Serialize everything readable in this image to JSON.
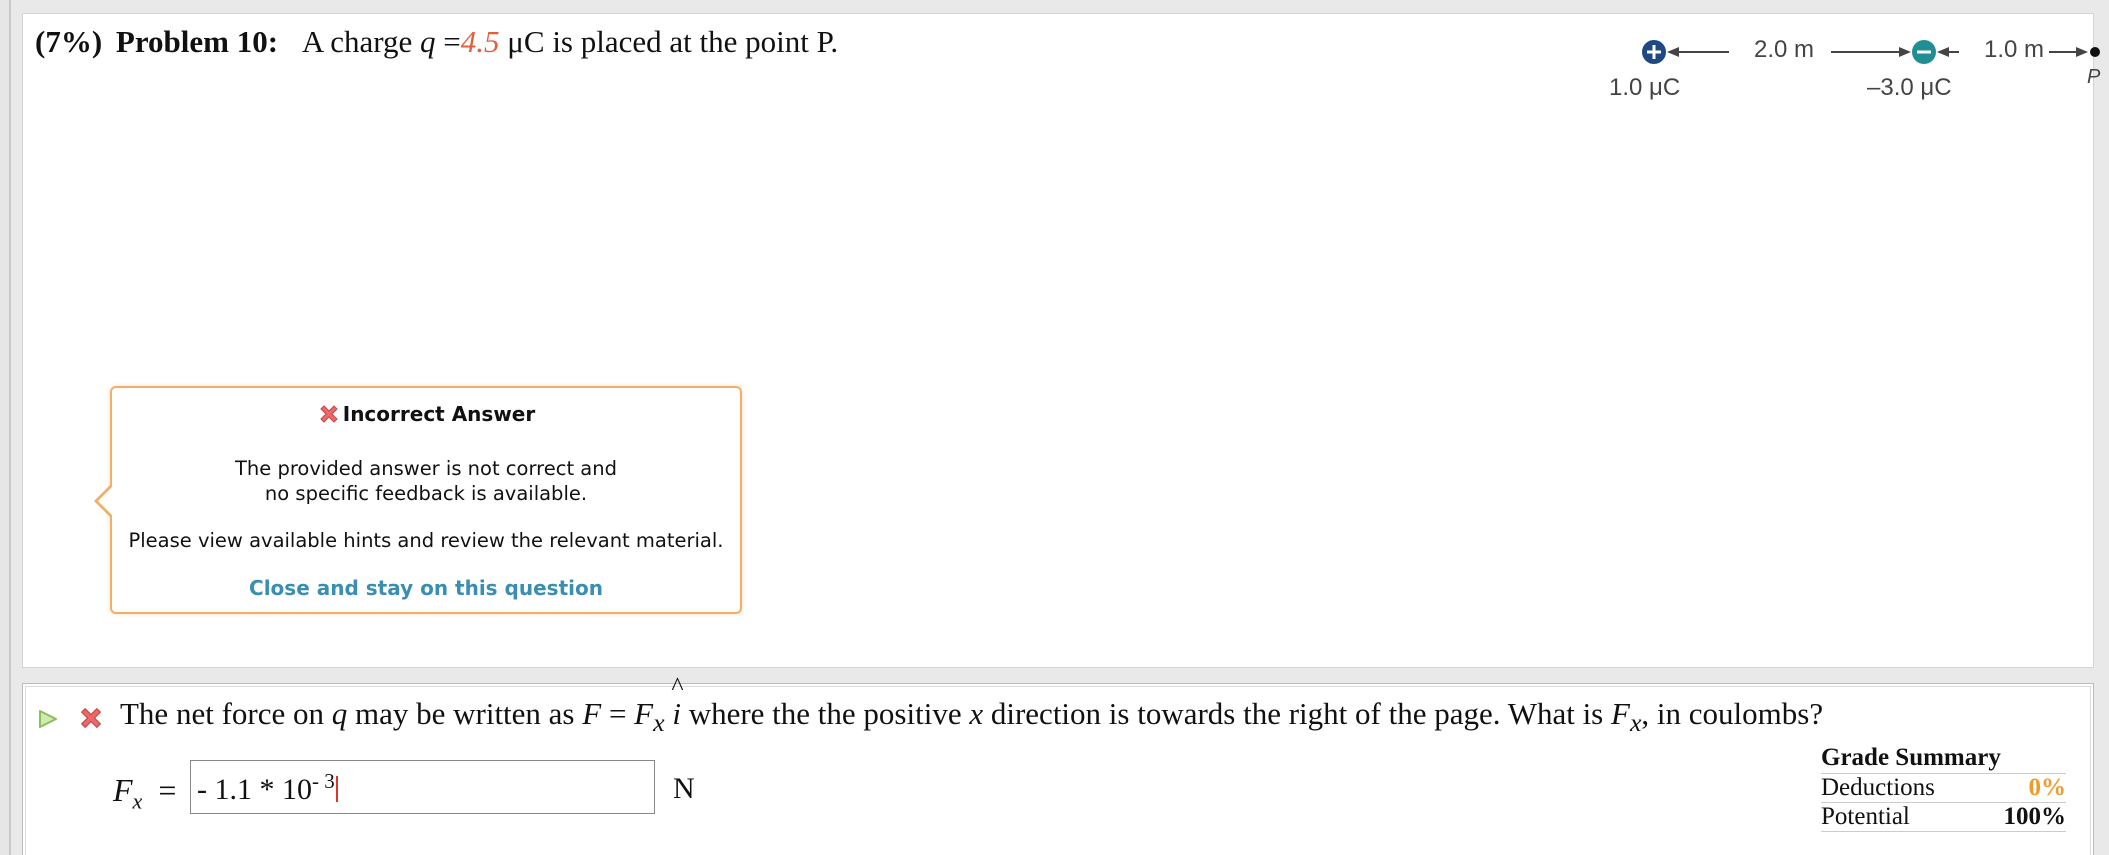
{
  "problem": {
    "weight": "(7%)",
    "title": "Problem 10:",
    "text_before": "A charge",
    "var": "q",
    "equals": "=",
    "charge_value": "4.5",
    "text_after": "μC is placed at the point P."
  },
  "diagram": {
    "charge1_label": "1.0 μC",
    "charge2_label": "–3.0 μC",
    "distance1": "2.0 m",
    "distance2": "1.0 m",
    "point_label": "P",
    "colors": {
      "charge": "#1d4a85",
      "negative": "#1f8f93",
      "line": "#444444"
    }
  },
  "popup": {
    "title": "Incorrect Answer",
    "message_line1": "The provided answer is not correct and",
    "message_line2": "no specific feedback is available.",
    "hint": "Please view available hints and review the relevant material.",
    "close_link": "Close and stay on this question"
  },
  "question": {
    "t1": "The net force on",
    "v1": "q",
    "t2": "may be written as",
    "F": "F",
    "eq": " = ",
    "Fx": "F",
    "x_sub": "x",
    "i": "i",
    "t3": "where the the positive",
    "v2": "x",
    "t4": "direction is towards the right of the page. What is",
    "F2": "F",
    "x_sub2": "x",
    "t5": ", in coulombs?"
  },
  "answer": {
    "label_var": "F",
    "label_sub": "x",
    "label_eq": "=",
    "input_base": "- 1.1 * 10",
    "input_exp": "- 3",
    "unit": "N"
  },
  "grade_summary": {
    "title": "Grade Summary",
    "deductions_label": "Deductions",
    "deductions_value": "0%",
    "potential_label": "Potential",
    "potential_value": "100%"
  }
}
